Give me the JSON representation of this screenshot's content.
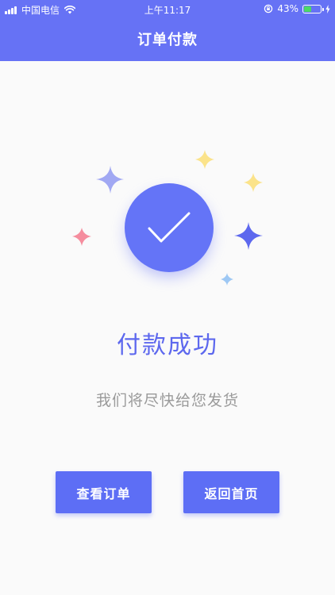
{
  "status_bar": {
    "carrier": "中国电信",
    "time": "上午11:17",
    "battery_percent": "43%",
    "battery_level": 0.43
  },
  "header": {
    "title": "订单付款",
    "color": "#6672f5"
  },
  "result": {
    "title": "付款成功",
    "subtitle": "我们将尽快给您发货"
  },
  "actions": {
    "view_order_label": "查看订单",
    "back_home_label": "返回首页"
  },
  "colors": {
    "accent": "#5d6ef5",
    "check_circle": "#6474f7",
    "sparkle_purple_light": "#a1a8f3",
    "sparkle_purple": "#5d68ee",
    "sparkle_yellow": "#fbe38a",
    "sparkle_pink": "#f58d9e",
    "sparkle_blue": "#9ec8f4"
  },
  "icons": {
    "success": "checkmark-circle-icon",
    "decor": "sparkle-icon"
  }
}
